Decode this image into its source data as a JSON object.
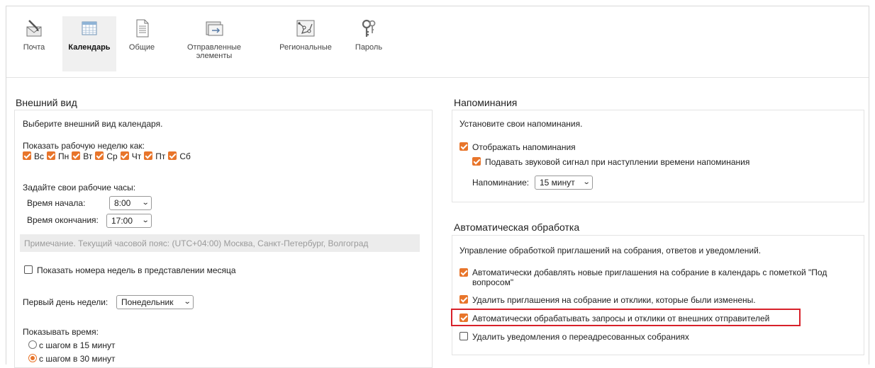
{
  "toolbar": {
    "items": [
      {
        "label": "Почта",
        "icon": "mail-icon"
      },
      {
        "label": "Календарь",
        "icon": "calendar-icon",
        "active": true
      },
      {
        "label": "Общие",
        "icon": "general-icon"
      },
      {
        "label": "Отправленные элементы",
        "icon": "sent-items-icon"
      },
      {
        "label": "Региональные",
        "icon": "regional-icon"
      },
      {
        "label": "Пароль",
        "icon": "password-icon"
      }
    ]
  },
  "appearance": {
    "title": "Внешний вид",
    "intro": "Выберите внешний вид календаря.",
    "workweek_label": "Показать рабочую неделю как:",
    "days": [
      {
        "label": "Вс",
        "checked": true
      },
      {
        "label": "Пн",
        "checked": true
      },
      {
        "label": "Вт",
        "checked": true
      },
      {
        "label": "Ср",
        "checked": true
      },
      {
        "label": "Чт",
        "checked": true
      },
      {
        "label": "Пт",
        "checked": true
      },
      {
        "label": "Сб",
        "checked": true
      }
    ],
    "hours_label": "Задайте свои рабочие часы:",
    "start_label": "Время начала:",
    "start_value": "8:00",
    "end_label": "Время окончания:",
    "end_value": "17:00",
    "timezone_note": "Примечание. Текущий часовой пояс: (UTC+04:00) Москва, Санкт-Петербург, Волгоград",
    "week_numbers_label": "Показать номера недель в представлении месяца",
    "week_numbers_checked": false,
    "first_day_label": "Первый день недели:",
    "first_day_value": "Понедельник",
    "show_time_label": "Показывать время:",
    "time_options": [
      {
        "label": "с шагом в 15 минут",
        "selected": false
      },
      {
        "label": "с шагом в 30 минут",
        "selected": true
      }
    ]
  },
  "reminders": {
    "title": "Напоминания",
    "intro": "Установите свои напоминания.",
    "show_label": "Отображать напоминания",
    "show_checked": true,
    "sound_label": "Подавать звуковой сигнал при наступлении времени напоминания",
    "sound_checked": true,
    "reminder_label": "Напоминание:",
    "reminder_value": "15 минут"
  },
  "auto": {
    "title": "Автоматическая обработка",
    "intro": "Управление обработкой приглашений на собрания, ответов и уведомлений.",
    "options": [
      {
        "label": "Автоматически добавлять новые приглашения на собрание в календарь с пометкой \"Под",
        "label2": "вопросом\"",
        "checked": true
      },
      {
        "label": "Удалить приглашения на собрание и отклики, которые были изменены.",
        "checked": true
      },
      {
        "label": "Автоматически обрабатывать запросы и отклики от внешних отправителей",
        "checked": true
      },
      {
        "label": "Удалить уведомления о переадресованных собраниях",
        "checked": false
      }
    ]
  },
  "colors": {
    "accent": "#e8752b",
    "highlight": "#d8212a"
  }
}
